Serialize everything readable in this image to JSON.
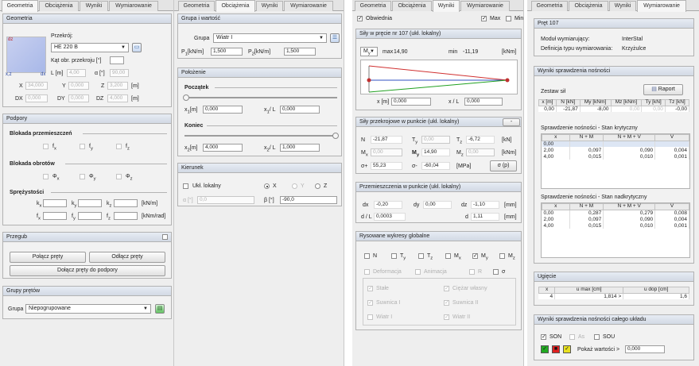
{
  "p1": {
    "tabs": [
      "Geometria",
      "Obciążenia",
      "Wyniki",
      "Wymiarowanie"
    ],
    "geometry": {
      "title": "Geometria",
      "profile_label": "Przekrój:",
      "profile_value": "HE 220 B",
      "angle_label": "Kąt obr. przekroju [°]",
      "L_label": "L [m]",
      "L_value": "4,00",
      "alpha_label": "α [°]",
      "alpha_value": "90,00",
      "X_label": "X",
      "X_value": "34,000",
      "Y_label": "Y",
      "Y_value": "0,000",
      "Z_label": "Z",
      "Z_value": "3,200",
      "unit_m": "[m]",
      "DX_label": "DX",
      "DX_value": "0,000",
      "DY_label": "DY",
      "DY_value": "0,000",
      "DZ_label": "DZ",
      "DZ_value": "4,000",
      "unit_m2": "[m]",
      "dz": "dz",
      "xz": "x,z",
      "dx": "dx"
    },
    "supports": {
      "title": "Podpory",
      "block_disp": "Blokada przemieszczeń",
      "fx": "f",
      "fy": "f",
      "fz": "f",
      "sx": "x",
      "sy": "y",
      "sz": "z",
      "block_rot": "Blokada obrotów",
      "phi": "Φ",
      "spring": "Sprężystości",
      "k": "k",
      "f": "f",
      "unit1": "[kN/m]",
      "unit2": "[kNm/rad]"
    },
    "joint": {
      "title": "Przegub",
      "connect": "Połącz pręty",
      "disconnect": "Odłącz pręty",
      "connect_support": "Dołącz pręty do podpory"
    },
    "groups": {
      "title": "Grupy prętów",
      "label": "Grupa",
      "value": "Niepogrupowane"
    }
  },
  "p2": {
    "tabs": [
      "Geometria",
      "Obciążenia",
      "Wyniki",
      "Wymiarowanie"
    ],
    "group": {
      "title": "Grupa i wartość",
      "label": "Grupa",
      "value": "Wiatr I",
      "p1_label": "P",
      "p1_sub": "1",
      "p1_unit": "[kN/m]",
      "p1_value": "1,500",
      "p2_label": "P",
      "p2_sub": "2",
      "p2_unit": "[kN/m]",
      "p2_value": "1,500"
    },
    "position": {
      "title": "Położenie",
      "start": "Początek",
      "x1_label": "[m]",
      "x1_value": "0,000",
      "x1L_label": "/ L",
      "x1L_value": "0,000",
      "end": "Koniec",
      "x2_label": "[m]",
      "x2_value": "4,000",
      "x2L_label": "/ L",
      "x2L_value": "1,000",
      "xsub1": "1",
      "xsub2": "2",
      "x": "x"
    },
    "direction": {
      "title": "Kierunek",
      "local": "Ukł. lokalny",
      "X": "X",
      "Y": "Y",
      "Z": "Z",
      "alpha_label": "α [°]",
      "alpha_value": "0,0",
      "beta_label": "β [°]",
      "beta_value": "-90,0"
    }
  },
  "p3": {
    "tabs": [
      "Geometria",
      "Obciążenia",
      "Wyniki",
      "Wymiarowanie"
    ],
    "top": {
      "envelope": "Obwiednia",
      "max": "Max",
      "min": "Min"
    },
    "forces": {
      "title": "Siły w pręcie nr 107 (ukł. lokalny)",
      "sel": "M",
      "sel_sub": "y",
      "max_label": "max",
      "max_value": "14,90",
      "min_label": "min",
      "min_value": "-11,19",
      "unit": "[kNm]",
      "x_label": "x [m]",
      "x_value": "0,000",
      "xL_label": "x / L",
      "xL_value": "0,000"
    },
    "point": {
      "title": "Siły przekrojowe w punkcie (ukł. lokalny)",
      "N_label": "N",
      "N_value": "-21,87",
      "Ty_label": "T",
      "Ty_value": "0,00",
      "Tz_label": "T",
      "Tz_value": "-6,72",
      "unit1": "[kN]",
      "Mx_label": "M",
      "Mx_value": "0,00",
      "My_label": "M",
      "My_value": "14,90",
      "Mz_label": "M",
      "Mz_value": "0,00",
      "unit2": "[kNm]",
      "sp_label": "σ+",
      "sp_value": "55,23",
      "sm_label": "σ-",
      "sm_value": "-60,04",
      "unit3": "[MPa]",
      "sigma_btn": "σ (p)",
      "y": "y",
      "z": "z",
      "x": "x"
    },
    "disp": {
      "title": "Przemieszczenia w punkcie (ukł. lokalny)",
      "dx_label": "dx",
      "dx_value": "-0,20",
      "dy_label": "dy",
      "dy_value": "0,00",
      "dz_label": "dz",
      "dz_value": "-1,10",
      "unit": "[mm]",
      "dL_label": "d / L",
      "dL_value": "0,0003",
      "d_label": "d",
      "d_value": "1,11",
      "unit2": "[mm]"
    },
    "global": {
      "title": "Rysowane wykresy globalne",
      "N": "N",
      "T": "T",
      "M": "M",
      "y": "y",
      "z": "z",
      "x": "x",
      "deform": "Deformacja",
      "anim": "Animacja",
      "R": "R",
      "sigma": "σ",
      "stale": "Stałe",
      "ciezar": "Ciężar własny",
      "suwnica1": "Suwnica I",
      "suwnica2": "Suwnica II",
      "wiatr1": "Wiatr I",
      "wiatr2": "Wiatr II"
    }
  },
  "p4": {
    "tabs": [
      "Geometria",
      "Obciążenia",
      "Wyniki",
      "Wymiarowanie"
    ],
    "rod": {
      "title": "Pręt 107",
      "module_label": "Moduł wymiarujący:",
      "module_value": "InterStal",
      "def_label": "Definicja typu wymiarowania:",
      "def_value": "Krzyżulce"
    },
    "results": {
      "title": "Wyniki sprawdzenia nośności",
      "set": "Zestaw sił",
      "report": "Raport",
      "forces_head": [
        "x [m]",
        "N [kN]",
        "My [kNm]",
        "Mz [kNm]",
        "Ty [kN]",
        "Tz [kN]"
      ],
      "forces_row": [
        "0,00",
        "-21,87",
        "-8,00",
        "0,00",
        "0,00",
        "-0,00"
      ],
      "crit_title": "Sprawdzenie nośności - Stan krytyczny",
      "crit_head": [
        "x",
        "N + M",
        "N + M + V",
        "V"
      ],
      "crit_rows": [
        [
          "0,00",
          "",
          "",
          ""
        ],
        [
          "2,00",
          "0,097",
          "0,090",
          "0,004"
        ],
        [
          "4,00",
          "0,015",
          "0,010",
          "0,001"
        ]
      ],
      "super_title": "Sprawdzenie nośności - Stan nadkrytyczny",
      "super_head": [
        "x",
        "N + M",
        "N + M + V",
        "V"
      ],
      "super_rows": [
        [
          "0,00",
          "0,287",
          "0,279",
          "0,008"
        ],
        [
          "2,00",
          "0,097",
          "0,090",
          "0,004"
        ],
        [
          "4,00",
          "0,015",
          "0,010",
          "0,001"
        ]
      ]
    },
    "deflect": {
      "title": "Ugięcie",
      "head": [
        "x",
        "u max [cm]",
        "u dop [cm]"
      ],
      "row": [
        "4",
        "1,814",
        "1,6"
      ],
      "gt": ">"
    },
    "whole": {
      "title": "Wyniki sprawdzenia nośności całego układu",
      "son": "SON",
      "as": "As",
      "sou": "SOU",
      "show_label": "Pokaż wartości >",
      "show_value": "0,000"
    }
  },
  "colors": {
    "green": "#22aa22",
    "red": "#e02020",
    "yellow": "#e8e020",
    "graph_red": "#d03030",
    "graph_green": "#20a020",
    "graph_blue": "#3050c0"
  }
}
